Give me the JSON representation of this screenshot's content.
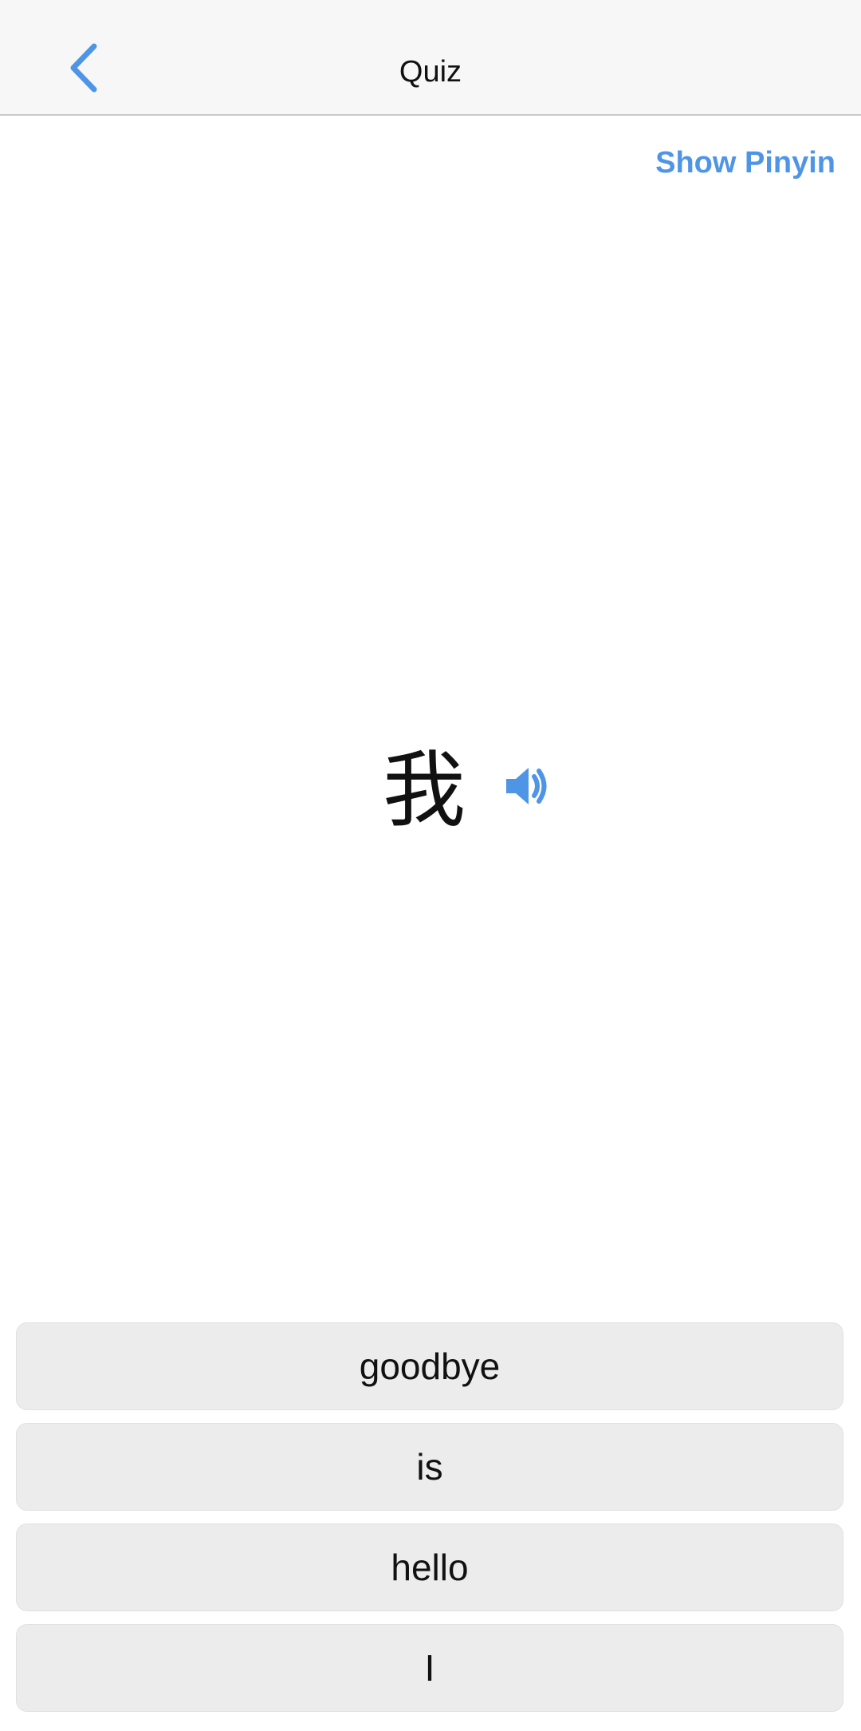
{
  "header": {
    "title": "Quiz",
    "back_icon": "chevron-left-icon"
  },
  "toolbar": {
    "show_pinyin_label": "Show Pinyin"
  },
  "prompt": {
    "character": "我",
    "audio_icon": "speaker-icon"
  },
  "answers": [
    {
      "label": "goodbye"
    },
    {
      "label": "is"
    },
    {
      "label": "hello"
    },
    {
      "label": "I"
    }
  ],
  "colors": {
    "accent": "#4f95e6",
    "header_background": "#f7f7f7",
    "answer_background": "#ececec",
    "text": "#111111"
  }
}
